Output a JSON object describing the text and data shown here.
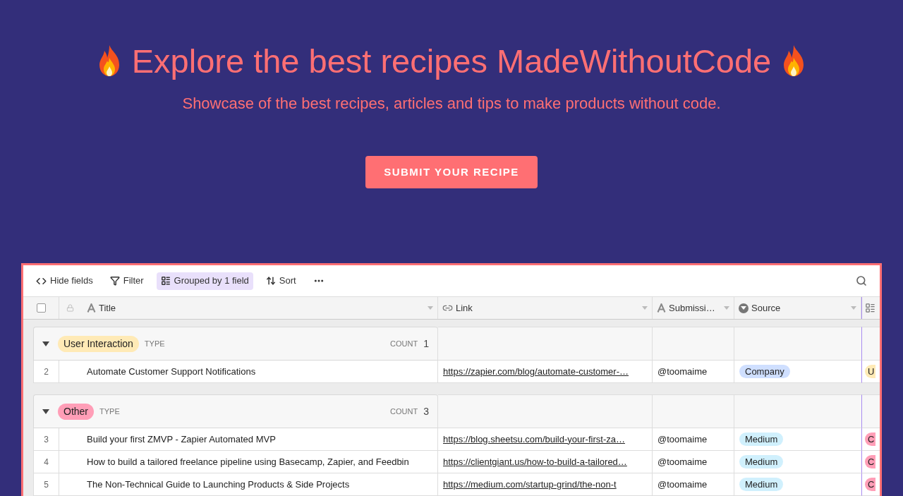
{
  "hero": {
    "title": "Explore the best recipes MadeWithoutCode",
    "subtitle": "Showcase of the best recipes, articles and tips to make products without code.",
    "button": "SUBMIT YOUR RECIPE"
  },
  "toolbar": {
    "items": [
      {
        "kind": "hide",
        "label": "Hide fields",
        "selected": false
      },
      {
        "kind": "filter",
        "label": "Filter",
        "selected": false
      },
      {
        "kind": "group",
        "label": "Grouped by 1 field",
        "selected": true
      },
      {
        "kind": "sort",
        "label": "Sort",
        "selected": false
      },
      {
        "kind": "more",
        "selected": false
      }
    ]
  },
  "table": {
    "select_all": {
      "checked": false
    },
    "columns": [
      {
        "kind": "text",
        "label": "Title"
      },
      {
        "kind": "link",
        "label": "Link"
      },
      {
        "kind": "text",
        "label": "Submissi…"
      },
      {
        "kind": "select",
        "label": "Source"
      }
    ],
    "groups": [
      {
        "tag": "User Interaction",
        "color": "#ffeab6",
        "field": "TYPE",
        "count_label": "COUNT",
        "count": "1",
        "expanded": true,
        "rows": [
          {
            "number": "2",
            "title": "Automate Customer Support Notifications",
            "link": "https://zapier.com/blog/automate-customer-…",
            "submitter": "@toomaime",
            "source": {
              "label": "Company",
              "color": "#cfdfff"
            },
            "column_5": {
              "label": "U",
              "color": "#ffeab6"
            }
          }
        ]
      },
      {
        "tag": "Other",
        "color": "#ff9eb7",
        "field": "TYPE",
        "count_label": "COUNT",
        "count": "3",
        "expanded": true,
        "rows": [
          {
            "number": "3",
            "title": "Build your first ZMVP - Zapier Automated MVP",
            "link": "https://blog.sheetsu.com/build-your-first-za…",
            "submitter": "@toomaime",
            "source": {
              "label": "Medium",
              "color": "#d0f0fd"
            },
            "column_5": {
              "label": "C",
              "color": "#ff9eb7"
            }
          },
          {
            "number": "4",
            "title": "How to build a tailored freelance pipeline using Basecamp, Zapier, and Feedbin",
            "link": "https://clientgiant.us/how-to-build-a-tailored…",
            "submitter": "@toomaime",
            "source": {
              "label": "Medium",
              "color": "#d0f0fd"
            },
            "column_5": {
              "label": "C",
              "color": "#ff9eb7"
            }
          },
          {
            "number": "5",
            "title": "The Non-Technical Guide to Launching Products & Side Projects",
            "link": "https://medium.com/startup-grind/the-non-t",
            "submitter": "@toomaime",
            "source": {
              "label": "Medium",
              "color": "#d0f0fd"
            },
            "column_5": {
              "label": "C",
              "color": "#ff9eb7"
            }
          }
        ]
      }
    ]
  }
}
